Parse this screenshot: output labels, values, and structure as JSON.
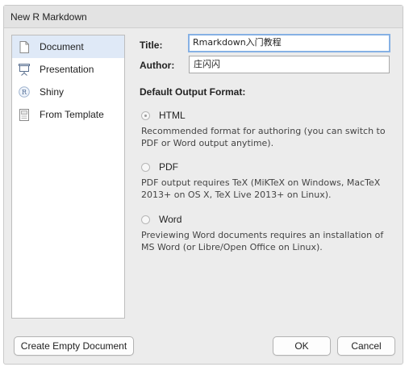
{
  "window": {
    "title": "New R Markdown"
  },
  "sidebar": {
    "items": [
      {
        "label": "Document",
        "icon": "document-icon",
        "selected": true
      },
      {
        "label": "Presentation",
        "icon": "presentation-icon",
        "selected": false
      },
      {
        "label": "Shiny",
        "icon": "shiny-r-icon",
        "selected": false
      },
      {
        "label": "From Template",
        "icon": "template-icon",
        "selected": false
      }
    ]
  },
  "form": {
    "title_label": "Title:",
    "title_value": "Rmarkdown入门教程",
    "author_label": "Author:",
    "author_value": "庄闪闪"
  },
  "output_format": {
    "heading": "Default Output Format:",
    "options": [
      {
        "label": "HTML",
        "checked": true,
        "description": "Recommended format for authoring (you can switch to PDF or Word output anytime)."
      },
      {
        "label": "PDF",
        "checked": false,
        "description": "PDF output requires TeX (MiKTeX on Windows, MacTeX 2013+ on OS X, TeX Live 2013+ on Linux)."
      },
      {
        "label": "Word",
        "checked": false,
        "description": "Previewing Word documents requires an installation of MS Word (or Libre/Open Office on Linux)."
      }
    ]
  },
  "buttons": {
    "create_empty": "Create Empty Document",
    "ok": "OK",
    "cancel": "Cancel"
  },
  "colors": {
    "selected_bg": "#dfe9f7",
    "focus_border": "#86b1e4",
    "window_bg": "#ececec"
  }
}
